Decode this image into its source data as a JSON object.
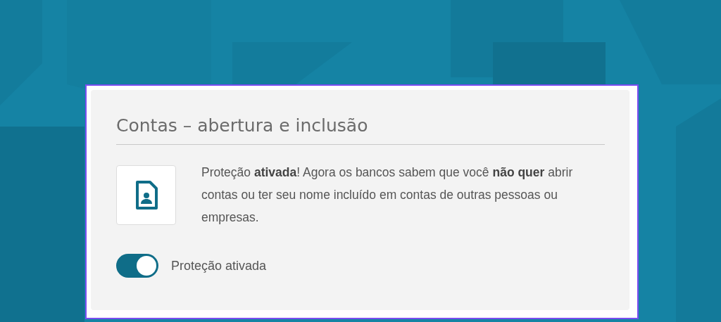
{
  "card": {
    "title": "Contas – abertura e inclusão",
    "message": "Proteção **ativada**! Agora os bancos sabem que você **não quer** abrir contas ou ter seu nome incluído em contas de outras pessoas ou empresas.",
    "toggle": {
      "label": "Proteção ativada",
      "on": true
    }
  }
}
